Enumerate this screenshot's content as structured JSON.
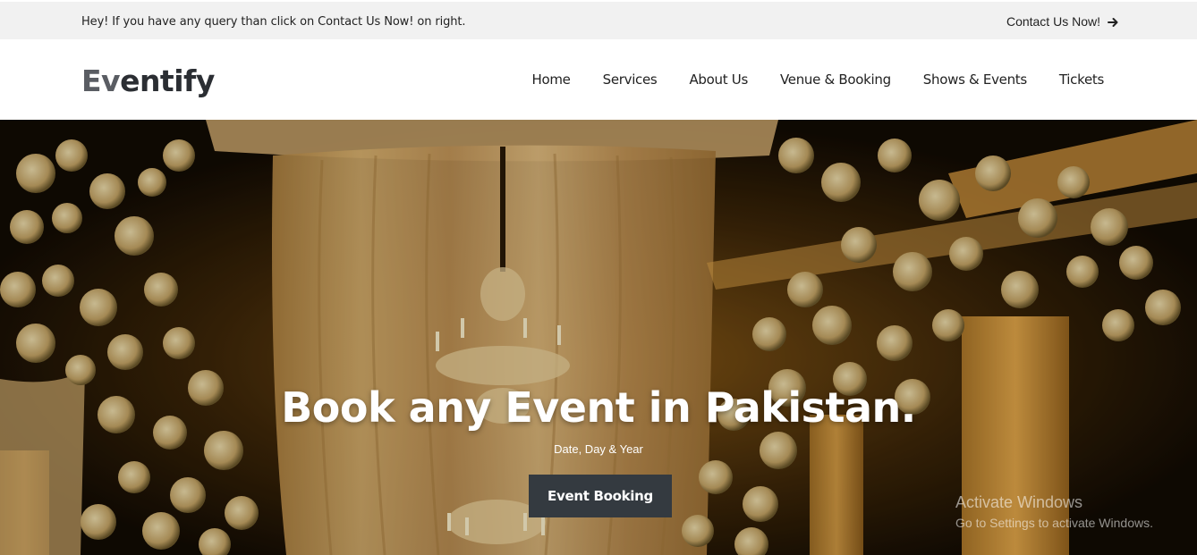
{
  "topbar": {
    "message": "Hey! If you have any query than click on Contact Us Now! on right.",
    "contact_label": "Contact Us Now!",
    "contact_icon": "arrow-right-icon"
  },
  "navbar": {
    "logo_part1": "Ev",
    "logo_part2": "entify",
    "items": [
      {
        "label": "Home"
      },
      {
        "label": "Services"
      },
      {
        "label": "About Us"
      },
      {
        "label": "Venue & Booking"
      },
      {
        "label": "Shows & Events"
      },
      {
        "label": "Tickets"
      }
    ]
  },
  "hero": {
    "title": "Book any Event in Pakistan.",
    "subtitle": "Date, Day & Year",
    "button_label": "Event Booking"
  },
  "watermark": {
    "title": "Activate Windows",
    "subtitle": "Go to Settings to activate Windows."
  },
  "colors": {
    "topbar_bg": "#f1f1f1",
    "button_bg": "#343a40",
    "logo_light": "#5a5d63",
    "logo_dark": "#2b2e33"
  }
}
